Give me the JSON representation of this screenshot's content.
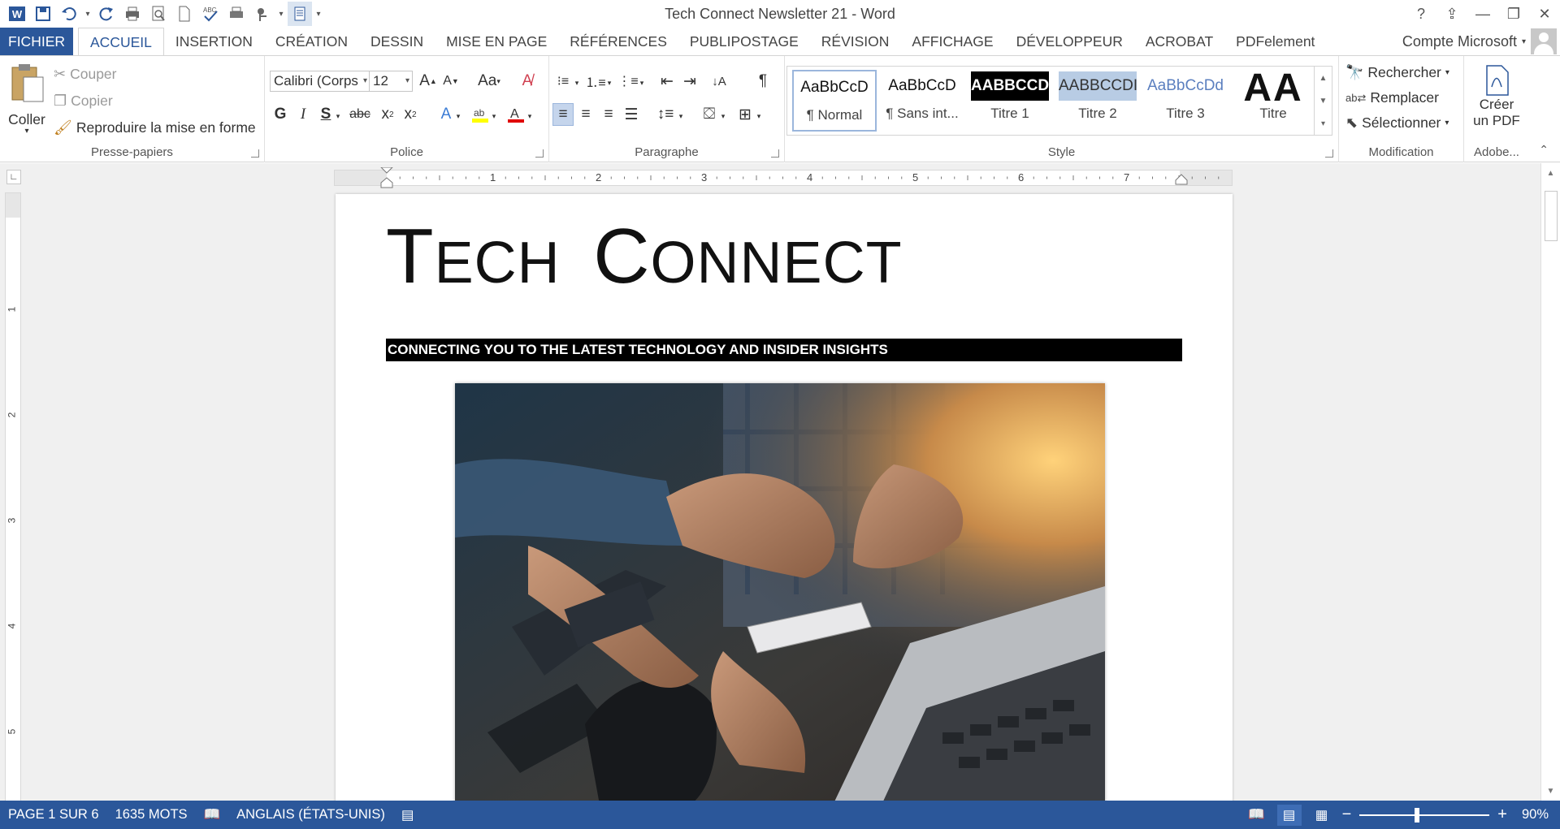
{
  "window": {
    "title": "Tech Connect Newsletter 21 - Word",
    "help": "?",
    "account": "Compte Microsoft"
  },
  "tabs": [
    "FICHIER",
    "ACCUEIL",
    "INSERTION",
    "CRÉATION",
    "DESSIN",
    "MISE EN PAGE",
    "RÉFÉRENCES",
    "PUBLIPOSTAGE",
    "RÉVISION",
    "AFFICHAGE",
    "DÉVELOPPEUR",
    "ACROBAT",
    "PDFelement"
  ],
  "active_tab": "ACCUEIL",
  "clipboard": {
    "paste": "Coller",
    "cut": "Couper",
    "copy": "Copier",
    "format_painter": "Reproduire la mise en forme",
    "label": "Presse-papiers"
  },
  "font": {
    "name": "Calibri (Corps",
    "size": "12",
    "case": "Aa",
    "bold": "G",
    "italic": "I",
    "shadow": "S",
    "strike": "abc",
    "label": "Police"
  },
  "paragraph": {
    "label": "Paragraphe"
  },
  "styles": {
    "label": "Style",
    "items": [
      {
        "preview": "AaBbCcD",
        "name": "¶ Normal"
      },
      {
        "preview": "AaBbCcD",
        "name": "¶ Sans int..."
      },
      {
        "preview": "AABBCCDI",
        "name": "Titre 1"
      },
      {
        "preview": "AABBCCDI",
        "name": "Titre 2"
      },
      {
        "preview": "AaBbCcDd",
        "name": "Titre 3"
      },
      {
        "preview": "AA",
        "name": "Titre"
      }
    ]
  },
  "editing": {
    "find": "Rechercher",
    "replace": "Remplacer",
    "select": "Sélectionner",
    "label": "Modification"
  },
  "adobe": {
    "create_line1": "Créer",
    "create_line2": "un PDF",
    "label": "Adobe..."
  },
  "ruler": {
    "numbers": [
      "1",
      "2",
      "3",
      "4",
      "5",
      "6",
      "7"
    ],
    "vnumbers": [
      "1",
      "2",
      "3",
      "4",
      "5"
    ]
  },
  "document": {
    "title_first_big": "T",
    "title_first_rest": "ECH",
    "title_second_big": "C",
    "title_second_rest": "ONNECT",
    "banner": "CONNECTING YOU TO THE LATEST TECHNOLOGY AND INSIDER INSIGHTS"
  },
  "status": {
    "page": "PAGE 1 SUR 6",
    "words": "1635 MOTS",
    "language": "ANGLAIS (ÉTATS-UNIS)",
    "zoom": "90%"
  },
  "colors": {
    "accent": "#2b579a",
    "highlight": "#ffff00",
    "font_color": "#e00000"
  }
}
